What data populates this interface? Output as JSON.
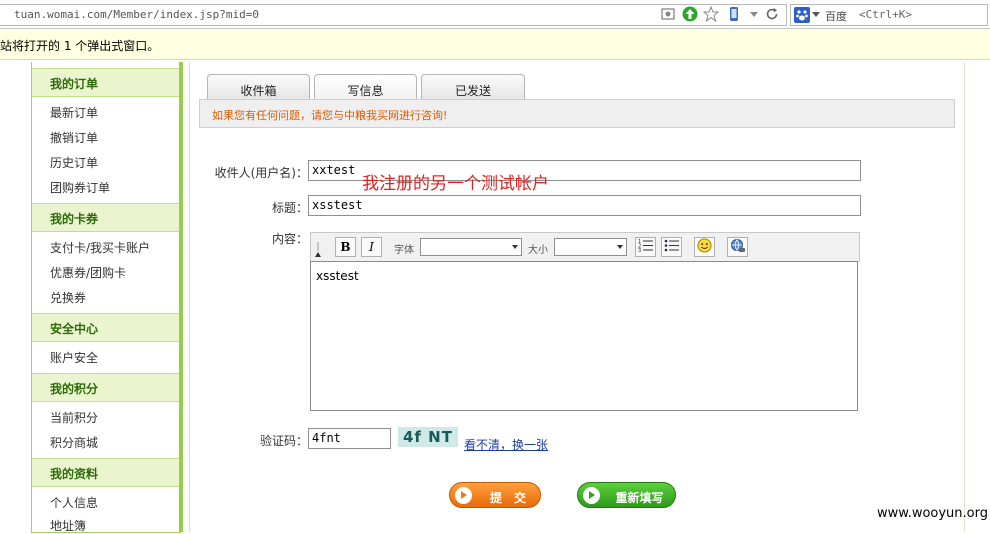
{
  "browser": {
    "url": "tuan.womai.com/Member/index.jsp?mid=0",
    "search_engine": "百度",
    "search_hint": "<Ctrl+K>"
  },
  "notice_bar": {
    "text": "站将打开的 1 个弹出式窗口。"
  },
  "sidebar": {
    "sections": [
      {
        "title": "我的订单",
        "items": [
          "最新订单",
          "撤销订单",
          "历史订单",
          "团购券订单"
        ]
      },
      {
        "title": "我的卡券",
        "items": [
          "支付卡/我买卡账户",
          "优惠券/团购卡",
          "兑换券"
        ]
      },
      {
        "title": "安全中心",
        "items": [
          "账户安全"
        ]
      },
      {
        "title": "我的积分",
        "items": [
          "当前积分",
          "积分商城"
        ]
      },
      {
        "title": "我的资料",
        "items": [
          "个人信息",
          "地址簿"
        ]
      }
    ]
  },
  "tabs": [
    {
      "label": "收件箱"
    },
    {
      "label": "写信息"
    },
    {
      "label": "已发送"
    }
  ],
  "message_bar": {
    "text": "如果您有任何问题，请您与中粮我买网进行咨询!"
  },
  "form": {
    "recipient_label": "收件人(用户名)：",
    "recipient_value": "xxtest",
    "annotation": "我注册的另一个测试帐户",
    "subject_label": "标题：",
    "subject_value": "xsstest",
    "content_label": "内容：",
    "content_value": "xsstest",
    "toolbar": {
      "bold": "B",
      "italic": "I",
      "font_label": "字体",
      "size_label": "大小"
    },
    "captcha_label": "验证码：",
    "captcha_value": "4fnt",
    "captcha_image_text": "4f NT",
    "captcha_refresh": "看不清，换一张",
    "submit_label": "提　交",
    "reset_label": "重新填写"
  },
  "watermark": "www.wooyun.org",
  "colors": {
    "sidebar_accent": "#9acb4a",
    "sidebar_title": "#2f6b0a",
    "notice_bg": "#ffffe1",
    "message_text": "#e05a00",
    "annotation": "#e02020",
    "submit_btn": "#f07a14",
    "reset_btn": "#3aa020"
  }
}
